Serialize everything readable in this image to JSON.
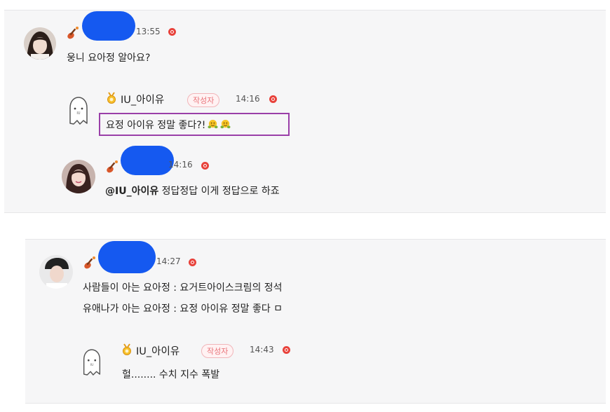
{
  "thread1": {
    "comment1": {
      "time": "13:55",
      "text": "웅니 요아정 알아요?"
    },
    "reply1": {
      "author": "IU_아이유",
      "badge": "작성자",
      "time": "14:16",
      "text": "요정 아이유 정말 좋다?!"
    },
    "reply2": {
      "time": "14:16",
      "mention": "@IU_아이유",
      "text": " 정답정답 이게 정답으로 하죠"
    }
  },
  "thread2": {
    "comment1": {
      "time": "14:27",
      "line1": "사람들이 아는 요아정 : 요거트아이스크림의 정석",
      "line2": "유애나가 아는 요아정 : 요정 아이유 정말 좋다 ㅁ"
    },
    "reply1": {
      "author": "IU_아이유",
      "badge": "작성자",
      "time": "14:43",
      "text": "헐........ 수치 지수 폭발"
    }
  },
  "icons": {
    "level_badge": "violin-icon",
    "author_badge": "gold-medal-icon",
    "status_dot": "record-dot-icon",
    "emoji": "hugging-face-emoji"
  },
  "colors": {
    "redaction": "#1559f0",
    "highlight_border": "#9a3fa8",
    "badge_text": "#e9747a",
    "status_dot": "#e8423b"
  }
}
